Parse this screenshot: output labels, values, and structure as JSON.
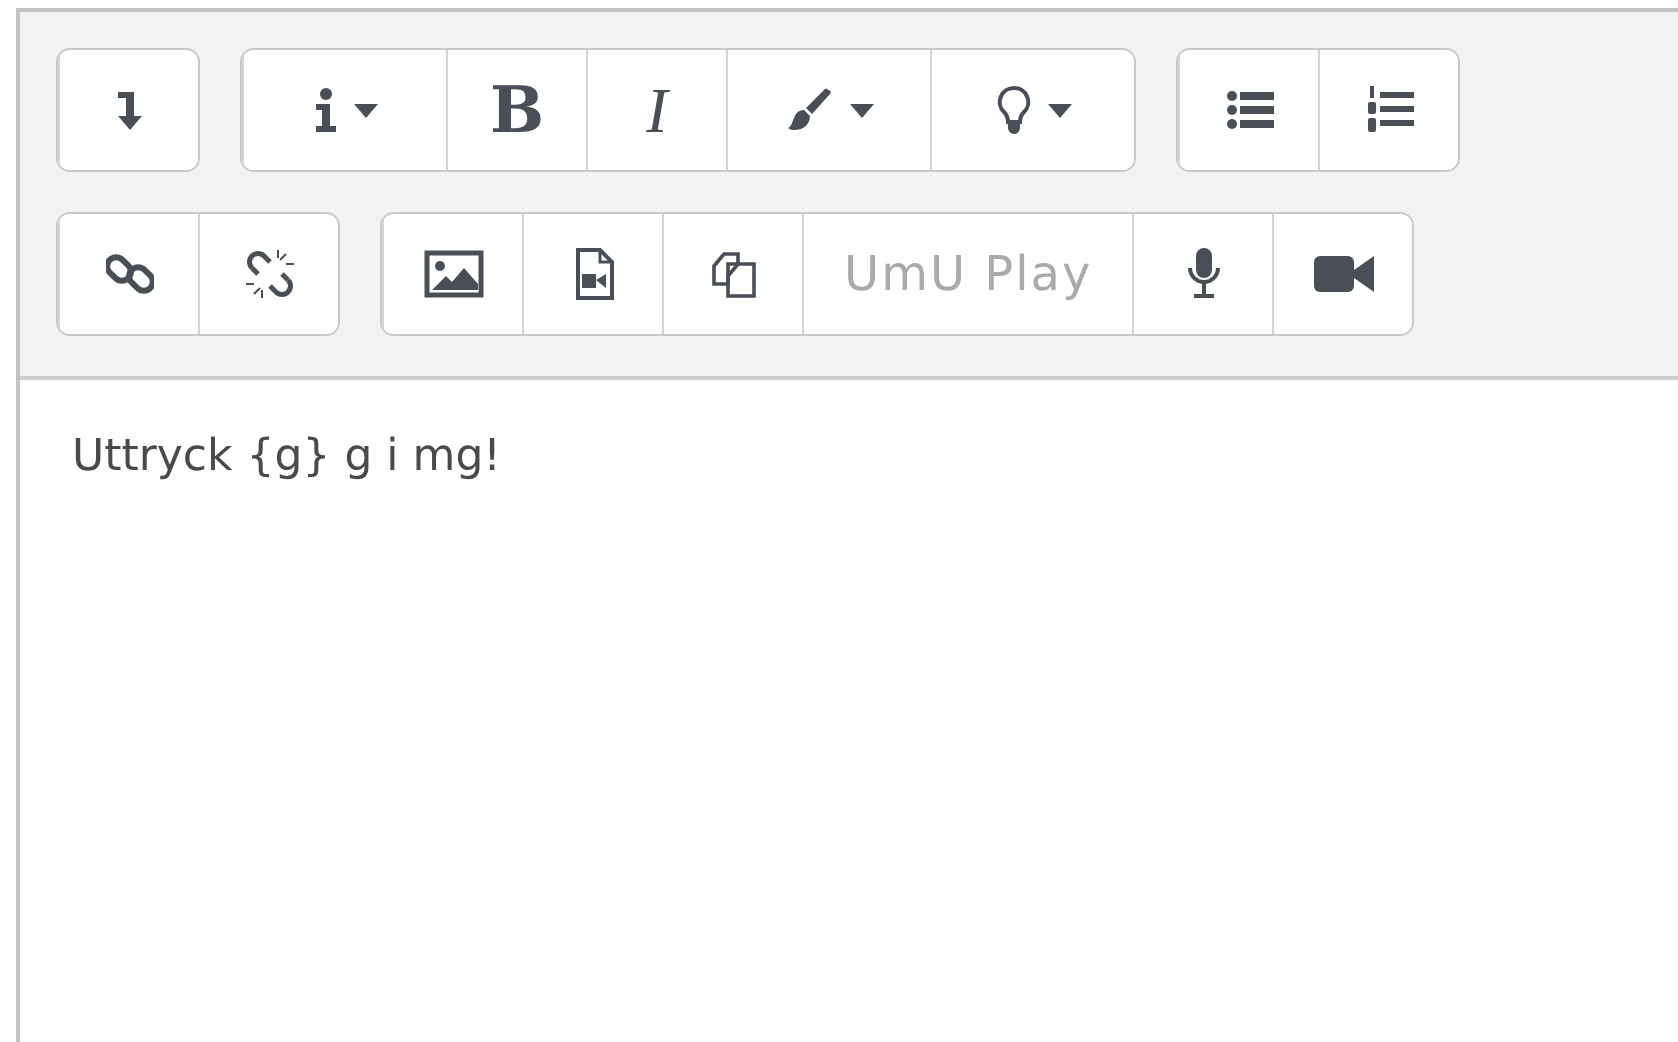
{
  "toolbar": {
    "rows": [
      [
        {
          "buttons": [
            {
              "kind": "collapse"
            }
          ]
        },
        {
          "buttons": [
            {
              "kind": "paragraph",
              "dropdown": true
            },
            {
              "kind": "bold",
              "label": "B"
            },
            {
              "kind": "italic",
              "label": "I"
            },
            {
              "kind": "color",
              "dropdown": true
            },
            {
              "kind": "bulb",
              "dropdown": true
            }
          ]
        },
        {
          "buttons": [
            {
              "kind": "bullets"
            },
            {
              "kind": "numbers"
            }
          ]
        }
      ],
      [
        {
          "buttons": [
            {
              "kind": "link"
            },
            {
              "kind": "unlink"
            }
          ]
        },
        {
          "buttons": [
            {
              "kind": "image"
            },
            {
              "kind": "media"
            },
            {
              "kind": "copy"
            },
            {
              "kind": "text",
              "label": "UmU Play"
            },
            {
              "kind": "mic"
            },
            {
              "kind": "camera"
            }
          ]
        }
      ]
    ]
  },
  "editor": {
    "text": "Uttryck {g} g i mg!"
  }
}
